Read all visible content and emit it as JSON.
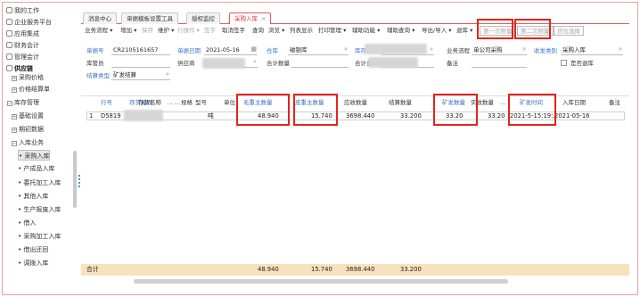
{
  "sidebar": {
    "items": [
      {
        "label": "我的工作",
        "icon": "home-icon"
      },
      {
        "label": "企业服务平台",
        "icon": "grid-icon"
      },
      {
        "label": "应用集成",
        "icon": "grid-icon"
      },
      {
        "label": "财务会计",
        "icon": "globe-icon"
      },
      {
        "label": "管理会计",
        "icon": "grid-icon"
      },
      {
        "label": "供应链",
        "icon": "box-icon"
      },
      {
        "label": "采购价格",
        "sign": "+"
      },
      {
        "label": "价格结算单",
        "sign": "+"
      },
      {
        "label": "库存管理",
        "sign": "-"
      },
      {
        "label": "基础设置",
        "sign": "+"
      },
      {
        "label": "期初数据",
        "sign": "+"
      },
      {
        "label": "入库业务",
        "sign": "-"
      },
      {
        "label": "采购入库"
      },
      {
        "label": "产成品入库"
      },
      {
        "label": "委托加工入库"
      },
      {
        "label": "其他入库"
      },
      {
        "label": "生产报废入库"
      },
      {
        "label": "借入"
      },
      {
        "label": "采购加工入库"
      },
      {
        "label": "借出还回"
      },
      {
        "label": "调拨入库"
      }
    ]
  },
  "tabs": [
    {
      "label": "消息中心"
    },
    {
      "label": "单据模板设置工具"
    },
    {
      "label": "授权监控"
    },
    {
      "label": "采购入库",
      "active": true
    }
  ],
  "toolbar": {
    "items": [
      "业务流程",
      "增加",
      "保存",
      "维护",
      "行操作",
      "签字",
      "取消签字",
      "查询",
      "浏览",
      "列表显示",
      "打印管理",
      "辅助功能",
      "辅助查询",
      "导出/导入",
      "退库"
    ],
    "weigh1": "第一次称量",
    "weigh2": "第二次称量",
    "bulk": "货位选择"
  },
  "form": {
    "doc_no_label": "单据号",
    "doc_no": "CR2105161657",
    "date_label": "单据日期",
    "date": "2021-05-16",
    "warehouse_label": "仓库",
    "warehouse": "磁银库",
    "org_label": "库存组织",
    "flow_label": "业务流程",
    "flow": "单公司采购",
    "dispatch_label": "收发类别",
    "dispatch": "采购入库",
    "keeper_label": "库管员",
    "supplier_label": "供应商",
    "total_qty_label": "合计数量",
    "total_label": "合计金额",
    "remark_label": "备注",
    "return_label": "是否退库",
    "settle_label": "结算类型",
    "settle": "矿发结算"
  },
  "grid": {
    "headers": [
      "行号",
      "存货编码",
      "存货名称",
      "规格",
      "型号",
      "单位",
      "毛重主数量",
      "皮重主数量",
      "应收数量",
      "结算数量",
      "矿发数量",
      "实收数量",
      "矿发时间",
      "入库日期",
      "备注"
    ],
    "rows": [
      {
        "no": "1",
        "code": "D5819",
        "unit": "吨",
        "gross": "48.940",
        "tare": "15.740",
        "due": "3698.440",
        "settle": "33.200",
        "mine": "33.20",
        "actual": "33.20",
        "mine_time": "2021-5-15:19:...",
        "in_date": "2021-05-16"
      }
    ],
    "totals": {
      "label": "合计",
      "gross": "48.940",
      "tare": "15.740",
      "due": "3698.440",
      "settle": "33.200"
    }
  }
}
